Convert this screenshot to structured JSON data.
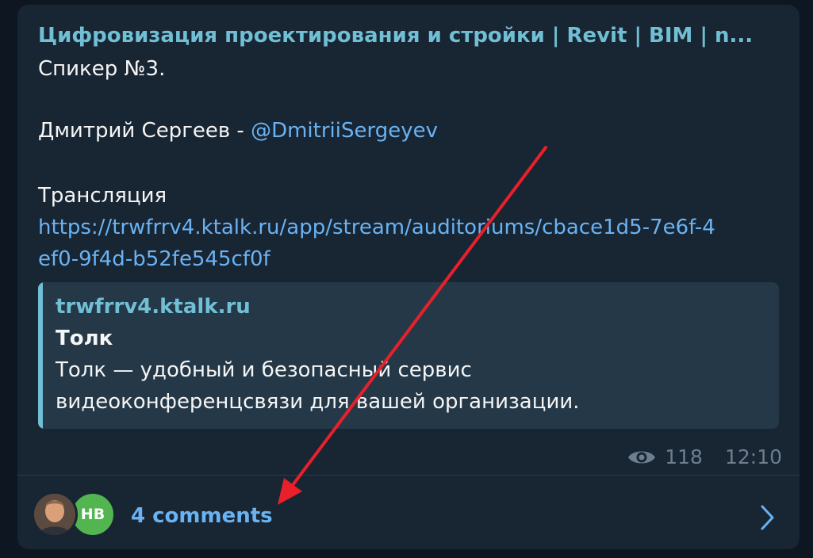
{
  "message": {
    "channel_title": "Цифровизация проектирования и стройки | Revit | BIM | n...",
    "speaker_line": "Спикер №3.",
    "name_prefix": "Дмитрий Сергеев - ",
    "mention": "@DmitriiSergeyev",
    "broadcast_label": "Трансляция",
    "link_line_1": "https://trwfrrv4.ktalk.ru/app/stream/auditoriums/cbace1d5-7e6f-4",
    "link_line_2": "ef0-9f4d-b52fe545cf0f"
  },
  "preview": {
    "site": "trwfrrv4.ktalk.ru",
    "title": "Толк",
    "description_line_1": "Толк — удобный и безопасный сервис",
    "description_line_2": "видеоконференцсвязи для вашей организации."
  },
  "meta": {
    "views": "118",
    "time": "12:10",
    "icon": "eye-icon"
  },
  "comments": {
    "label": "4 comments",
    "avatar_initials": "НВ",
    "avatar_initials_color": "#52b54f",
    "chevron_icon": "chevron-right-icon"
  },
  "colors": {
    "background": "#0e1621",
    "bubble": "#182533",
    "accent": "#71bfd4",
    "link": "#6ab3f3",
    "annotation_arrow": "#e8202a"
  }
}
